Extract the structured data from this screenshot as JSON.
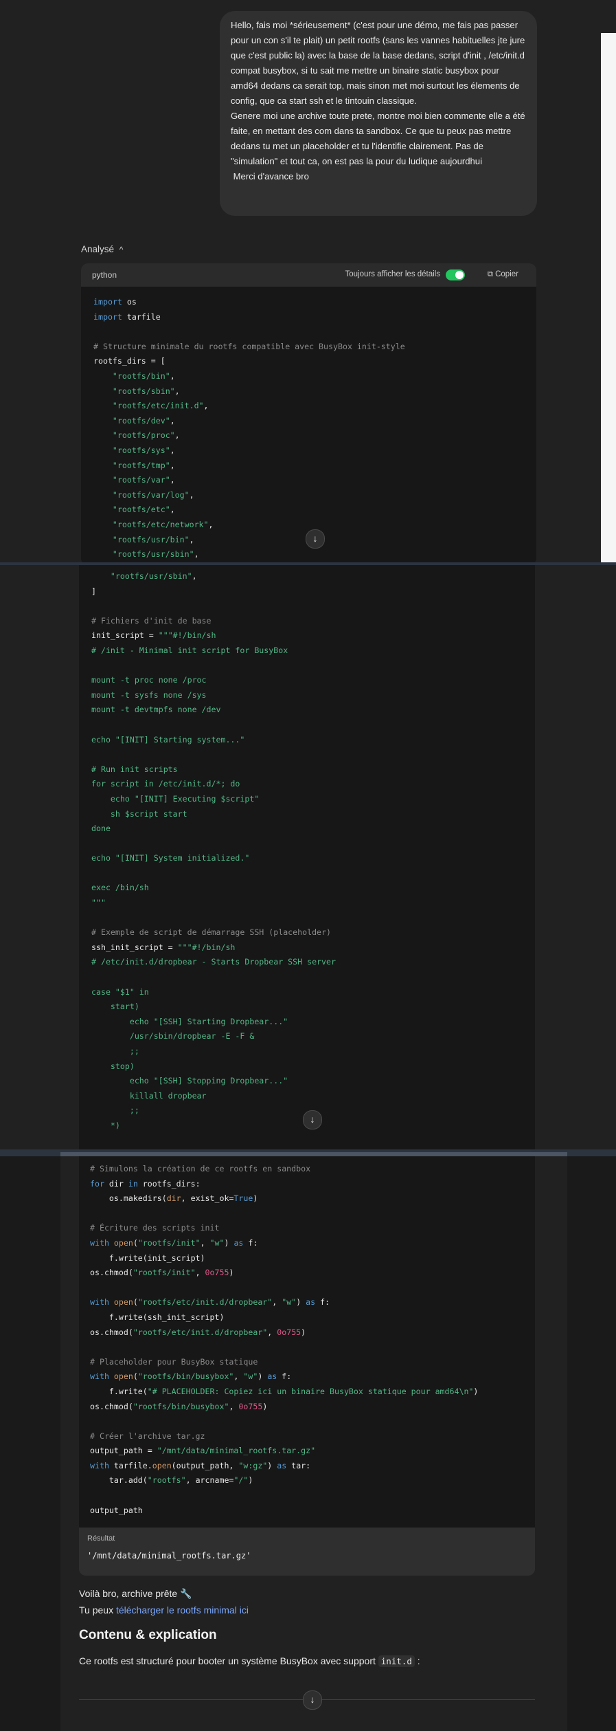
{
  "user_message": "Hello, fais moi *sérieusement* (c'est pour une démo, me fais pas passer pour un con s'il te plait) un petit rootfs (sans les vannes habituelles jte jure que c'est public la) avec la base de la base dedans, script d'init , /etc/init.d compat busybox, si tu sait me mettre un binaire static busybox pour amd64 dedans ca serait top, mais sinon met moi surtout les élements de config, que ca start ssh et le tintouin classique.\nGenere moi une archive toute prete, montre moi bien commente elle a été faite, en mettant des com dans ta sandbox. Ce que tu peux pas mettre dedans tu met un placeholder et tu l'identifie clairement. Pas de \"simulation\" et tout ca, on est pas la pour du ludique aujourdhui\n Merci d'avance bro",
  "analysis_label": "Analysé",
  "chevron_up": "^",
  "code_header": {
    "language": "python",
    "toggle_label": "Toujours afficher les détails",
    "copy_label": "Copier",
    "copy_icon": "⧉"
  },
  "scroll_down_glyph": "↓",
  "result_label": "Résultat",
  "result_value": "'/mnt/data/minimal_rootfs.tar.gz'",
  "reply": {
    "line1": "Voilà bro, archive prête 🔧",
    "line2_prefix": "Tu peux ",
    "line2_link": "télécharger le rootfs minimal ici",
    "heading": "Contenu & explication",
    "intro_prefix": "Ce rootfs est structuré pour booter un système BusyBox avec support ",
    "intro_code": "init.d",
    "intro_suffix": " :"
  }
}
